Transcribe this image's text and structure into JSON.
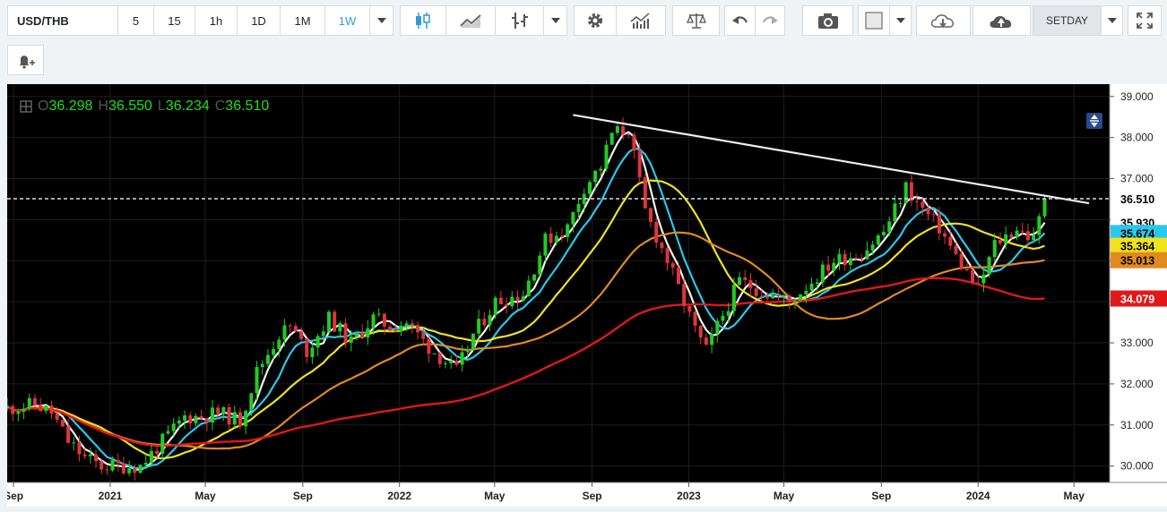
{
  "toolbar": {
    "symbol": "USD/THB",
    "intervals": [
      "5",
      "15",
      "1h",
      "1D",
      "1M",
      "1W"
    ],
    "active_interval": "1W",
    "setday_label": "SETDAY"
  },
  "ohlc": {
    "o_label": "O",
    "o": "36.298",
    "h_label": "H",
    "h": "36.550",
    "l_label": "L",
    "l": "36.234",
    "c_label": "C",
    "c": "36.510"
  },
  "colors": {
    "up": "#22cc22",
    "down": "#e0343c",
    "white_ma": "#f2f2f2",
    "cyan_ma": "#27c8ee",
    "yellow_ma": "#f2e21c",
    "orange_ma": "#e08a20",
    "red_ma": "#e01818"
  },
  "axis": {
    "y_ticks": [
      "39.000",
      "38.000",
      "37.000",
      "36.000",
      "35.000",
      "34.000",
      "33.000",
      "32.000",
      "31.000",
      "30.000"
    ],
    "x_ticks": [
      "Sep",
      "2021",
      "May",
      "Sep",
      "2022",
      "May",
      "Sep",
      "2023",
      "May",
      "Sep",
      "2024",
      "May"
    ],
    "labels": [
      {
        "text": "36.510",
        "bg": "#ffffff",
        "fg": "#000000"
      },
      {
        "text": "35.930",
        "bg": "#ffffff",
        "fg": "#000000"
      },
      {
        "text": "35.674",
        "bg": "#27c8ee",
        "fg": "#000000"
      },
      {
        "text": "35.364",
        "bg": "#f2e21c",
        "fg": "#000000"
      },
      {
        "text": "35.013",
        "bg": "#e08a20",
        "fg": "#000000"
      },
      {
        "text": "34.079",
        "bg": "#e01818",
        "fg": "#ffffff"
      }
    ]
  },
  "chart_data": {
    "type": "candlestick",
    "title": "USD/THB",
    "interval": "1W",
    "ylim": [
      29.6,
      39.3
    ],
    "x_range": [
      "2020-08-24",
      "2024-06-15"
    ],
    "last_close": 36.51,
    "price_path": [
      [
        "2020-08-24",
        31.4
      ],
      [
        "2020-09-28",
        31.5
      ],
      [
        "2020-10-19",
        31.3
      ],
      [
        "2020-11-09",
        30.6
      ],
      [
        "2020-11-30",
        30.2
      ],
      [
        "2020-12-21",
        30.0
      ],
      [
        "2021-01-11",
        30.0
      ],
      [
        "2021-02-08",
        30.0
      ],
      [
        "2021-03-08",
        30.6
      ],
      [
        "2021-04-05",
        31.2
      ],
      [
        "2021-04-26",
        31.2
      ],
      [
        "2021-05-17",
        31.3
      ],
      [
        "2021-06-14",
        31.1
      ],
      [
        "2021-07-05",
        32.3
      ],
      [
        "2021-08-02",
        33.2
      ],
      [
        "2021-08-16",
        33.4
      ],
      [
        "2021-09-06",
        32.8
      ],
      [
        "2021-10-04",
        33.6
      ],
      [
        "2021-11-01",
        33.0
      ],
      [
        "2021-11-29",
        33.6
      ],
      [
        "2021-12-20",
        33.4
      ],
      [
        "2022-01-10",
        33.5
      ],
      [
        "2022-02-07",
        32.9
      ],
      [
        "2022-03-14",
        32.3
      ],
      [
        "2022-04-04",
        33.2
      ],
      [
        "2022-05-02",
        34.0
      ],
      [
        "2022-06-06",
        34.2
      ],
      [
        "2022-07-04",
        35.5
      ],
      [
        "2022-08-01",
        35.8
      ],
      [
        "2022-08-22",
        36.8
      ],
      [
        "2022-09-12",
        37.3
      ],
      [
        "2022-09-26",
        38.1
      ],
      [
        "2022-10-17",
        38.2
      ],
      [
        "2022-11-07",
        36.2
      ],
      [
        "2022-12-05",
        35.0
      ],
      [
        "2023-01-09",
        33.3
      ],
      [
        "2023-01-23",
        32.8
      ],
      [
        "2023-02-06",
        33.4
      ],
      [
        "2023-03-06",
        34.5
      ],
      [
        "2023-04-10",
        34.2
      ],
      [
        "2023-05-08",
        34.0
      ],
      [
        "2023-06-05",
        34.5
      ],
      [
        "2023-07-03",
        35.0
      ],
      [
        "2023-08-07",
        35.2
      ],
      [
        "2023-09-04",
        35.7
      ],
      [
        "2023-10-02",
        36.8
      ],
      [
        "2023-10-16",
        36.4
      ],
      [
        "2023-11-13",
        35.8
      ],
      [
        "2023-12-04",
        35.1
      ],
      [
        "2024-01-01",
        34.3
      ],
      [
        "2024-01-22",
        35.4
      ],
      [
        "2024-02-19",
        35.8
      ],
      [
        "2024-03-11",
        35.5
      ],
      [
        "2024-03-25",
        36.5
      ]
    ],
    "moving_averages": [
      {
        "color": "white",
        "last": 35.93
      },
      {
        "color": "cyan",
        "last": 35.674
      },
      {
        "color": "yellow",
        "last": 35.364
      },
      {
        "color": "orange",
        "last": 35.013
      },
      {
        "color": "red",
        "last": 34.079
      }
    ],
    "trendline": {
      "from": [
        "2022-08-08",
        38.55
      ],
      "to": [
        "2024-05-20",
        36.4
      ]
    },
    "current_price_line": 36.51
  }
}
